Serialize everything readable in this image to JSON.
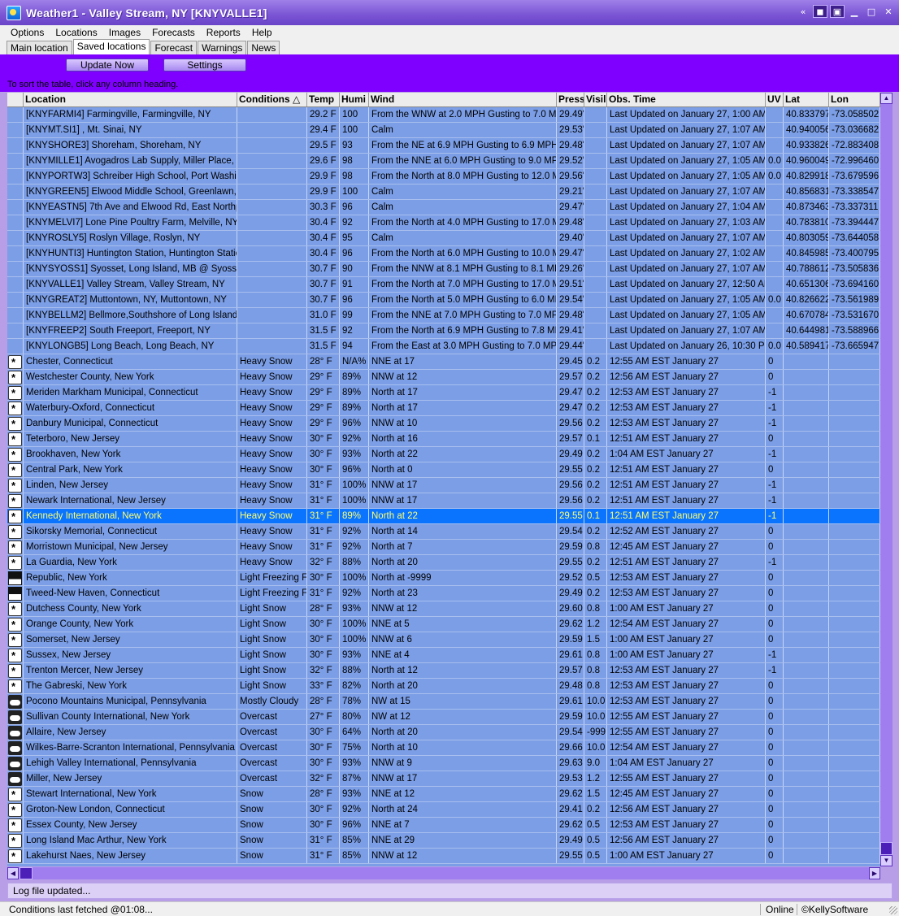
{
  "window": {
    "title": "Weather1 - Valley Stream, NY [KNYVALLE1]"
  },
  "menu": [
    "Options",
    "Locations",
    "Images",
    "Forecasts",
    "Reports",
    "Help"
  ],
  "tabs": [
    {
      "label": "Main location",
      "active": false
    },
    {
      "label": "Saved locations",
      "active": true
    },
    {
      "label": "Forecast",
      "active": false
    },
    {
      "label": "Warnings",
      "active": false
    },
    {
      "label": "News",
      "active": false
    }
  ],
  "toolbar": {
    "update_label": "Update Now",
    "settings_label": "Settings"
  },
  "hint": "To sort the table, click any column heading.",
  "columns": [
    "",
    "Location",
    "Conditions △",
    "Temp",
    "Humi",
    "Wind",
    "Press",
    "Visil",
    "Obs. Time",
    "UV",
    "Lat",
    "Lon"
  ],
  "rows": [
    {
      "icon": "",
      "location": "[KNYFARMI4] Farmingville, Farmingville, NY",
      "conditions": "",
      "temp": "29.2 F",
      "humidity": "100",
      "wind": "From the WNW at 2.0 MPH Gusting to 7.0 MPH",
      "press": "29.49\"",
      "vis": "",
      "obs": "Last Updated on January 27, 1:00 AM E",
      "uv": "",
      "lat": "40.833797",
      "lon": "-73.058502"
    },
    {
      "icon": "",
      "location": "[KNYMT.SI1] , Mt. Sinai, NY",
      "conditions": "",
      "temp": "29.4 F",
      "humidity": "100",
      "wind": "Calm",
      "press": "29.53\"",
      "vis": "",
      "obs": "Last Updated on January 27, 1:07 AM E",
      "uv": "",
      "lat": "40.940056",
      "lon": "-73.036682"
    },
    {
      "icon": "",
      "location": "[KNYSHORE3] Shoreham, Shoreham, NY",
      "conditions": "",
      "temp": "29.5 F",
      "humidity": "93",
      "wind": "From the NE at 6.9 MPH Gusting to 6.9 MPH",
      "press": "29.48\"",
      "vis": "",
      "obs": "Last Updated on January 27, 1:07 AM E",
      "uv": "",
      "lat": "40.933826",
      "lon": "-72.883408"
    },
    {
      "icon": "",
      "location": "[KNYMILLE1] Avogadros Lab Supply, Miller Place, NY",
      "conditions": "",
      "temp": "29.6 F",
      "humidity": "98",
      "wind": "From the NNE at 6.0 MPH Gusting to 9.0 MPH",
      "press": "29.52\"",
      "vis": "",
      "obs": "Last Updated on January 27, 1:05 AM E",
      "uv": "0.0",
      "lat": "40.960049",
      "lon": "-72.996460"
    },
    {
      "icon": "",
      "location": "[KNYPORTW3] Schreiber High School, Port Washington",
      "conditions": "",
      "temp": "29.9 F",
      "humidity": "98",
      "wind": "From the North at 8.0 MPH Gusting to 12.0 MPH",
      "press": "29.56\"",
      "vis": "",
      "obs": "Last Updated on January 27, 1:05 AM E",
      "uv": "0.0",
      "lat": "40.829918",
      "lon": "-73.679596"
    },
    {
      "icon": "",
      "location": "[KNYGREEN5] Elwood Middle School, Greenlawn, NY",
      "conditions": "",
      "temp": "29.9 F",
      "humidity": "100",
      "wind": "Calm",
      "press": "29.21\"",
      "vis": "",
      "obs": "Last Updated on January 27, 1:07 AM E",
      "uv": "",
      "lat": "40.856831",
      "lon": "-73.338547"
    },
    {
      "icon": "",
      "location": "[KNYEASTN5] 7th Ave and Elwood Rd, East Northport",
      "conditions": "",
      "temp": "30.3 F",
      "humidity": "96",
      "wind": "Calm",
      "press": "29.47\"",
      "vis": "",
      "obs": "Last Updated on January 27, 1:04 AM E",
      "uv": "",
      "lat": "40.873463",
      "lon": "-73.337311"
    },
    {
      "icon": "",
      "location": "[KNYMELVI7] Lone Pine Poultry Farm, Melville, NY",
      "conditions": "",
      "temp": "30.4 F",
      "humidity": "92",
      "wind": "From the North at 4.0 MPH Gusting to 17.0 MPH",
      "press": "29.48\"",
      "vis": "",
      "obs": "Last Updated on January 27, 1:03 AM E",
      "uv": "",
      "lat": "40.783810",
      "lon": "-73.394447"
    },
    {
      "icon": "",
      "location": "[KNYROSLY5] Roslyn Village, Roslyn, NY",
      "conditions": "",
      "temp": "30.4 F",
      "humidity": "95",
      "wind": "Calm",
      "press": "29.40\"",
      "vis": "",
      "obs": "Last Updated on January 27, 1:07 AM E",
      "uv": "",
      "lat": "40.803059",
      "lon": "-73.644058"
    },
    {
      "icon": "",
      "location": "[KNYHUNTI3] Huntington Station, Huntington Station,",
      "conditions": "",
      "temp": "30.4 F",
      "humidity": "96",
      "wind": "From the North at 6.0 MPH Gusting to 10.0 MPH",
      "press": "29.47\"",
      "vis": "",
      "obs": "Last Updated on January 27, 1:02 AM E",
      "uv": "",
      "lat": "40.845985",
      "lon": "-73.400795"
    },
    {
      "icon": "",
      "location": "[KNYSYOSS1] Syosset, Long Island, MB @ Syosset, N",
      "conditions": "",
      "temp": "30.7 F",
      "humidity": "90",
      "wind": "From the NNW at 8.1 MPH Gusting to 8.1 MPH",
      "press": "29.26\"",
      "vis": "",
      "obs": "Last Updated on January 27, 1:07 AM E",
      "uv": "",
      "lat": "40.788612",
      "lon": "-73.505836"
    },
    {
      "icon": "",
      "location": "[KNYVALLE1] Valley Stream, Valley Stream, NY",
      "conditions": "",
      "temp": "30.7 F",
      "humidity": "91",
      "wind": "From the North at 7.0 MPH Gusting to 17.0 MPH",
      "press": "29.51\"",
      "vis": "",
      "obs": "Last Updated on January 27, 12:50 AM",
      "uv": "",
      "lat": "40.651306",
      "lon": "-73.694160"
    },
    {
      "icon": "",
      "location": "[KNYGREAT2] Muttontown, NY, Muttontown, NY",
      "conditions": "",
      "temp": "30.7 F",
      "humidity": "96",
      "wind": "From the North at 5.0 MPH Gusting to 6.0 MPH",
      "press": "29.54\"",
      "vis": "",
      "obs": "Last Updated on January 27, 1:05 AM E",
      "uv": "0.0",
      "lat": "40.826622",
      "lon": "-73.561989"
    },
    {
      "icon": "",
      "location": "[KNYBELLM2] Bellmore,Southshore of Long Island, Bel",
      "conditions": "",
      "temp": "31.0 F",
      "humidity": "99",
      "wind": "From the NNE at 7.0 MPH Gusting to 7.0 MPH",
      "press": "29.48\"",
      "vis": "",
      "obs": "Last Updated on January 27, 1:05 AM E",
      "uv": "",
      "lat": "40.670784",
      "lon": "-73.531670"
    },
    {
      "icon": "",
      "location": "[KNYFREEP2] South Freeport, Freeport, NY",
      "conditions": "",
      "temp": "31.5 F",
      "humidity": "92",
      "wind": "From the North at 6.9 MPH Gusting to 7.8 MPH",
      "press": "29.41\"",
      "vis": "",
      "obs": "Last Updated on January 27, 1:07 AM E",
      "uv": "",
      "lat": "40.644981",
      "lon": "-73.588966"
    },
    {
      "icon": "",
      "location": "[KNYLONGB5] Long Beach, Long Beach, NY",
      "conditions": "",
      "temp": "31.5 F",
      "humidity": "94",
      "wind": "From the East at 3.0 MPH Gusting to 7.0 MPH",
      "press": "29.44\"",
      "vis": "",
      "obs": "Last Updated on January 26, 10:30 PM",
      "uv": "0.0",
      "lat": "40.589417",
      "lon": "-73.665947"
    },
    {
      "icon": "snow",
      "location": "Chester, Connecticut",
      "conditions": "Heavy Snow",
      "temp": "28° F",
      "humidity": "N/A%",
      "wind": "NNE at 17",
      "press": "29.45",
      "vis": "0.2",
      "obs": "12:55 AM EST January 27",
      "uv": "0",
      "lat": "",
      "lon": ""
    },
    {
      "icon": "snow",
      "location": "Westchester County, New York",
      "conditions": "Heavy Snow",
      "temp": "29° F",
      "humidity": "89%",
      "wind": "NNW at 12",
      "press": "29.57",
      "vis": "0.2",
      "obs": "12:56 AM EST January 27",
      "uv": "0",
      "lat": "",
      "lon": ""
    },
    {
      "icon": "snow",
      "location": "Meriden Markham Municipal, Connecticut",
      "conditions": "Heavy Snow",
      "temp": "29° F",
      "humidity": "89%",
      "wind": "North at 17",
      "press": "29.47",
      "vis": "0.2",
      "obs": "12:53 AM EST January 27",
      "uv": "-1",
      "lat": "",
      "lon": ""
    },
    {
      "icon": "snow",
      "location": "Waterbury-Oxford, Connecticut",
      "conditions": "Heavy Snow",
      "temp": "29° F",
      "humidity": "89%",
      "wind": "North at 17",
      "press": "29.47",
      "vis": "0.2",
      "obs": "12:53 AM EST January 27",
      "uv": "-1",
      "lat": "",
      "lon": ""
    },
    {
      "icon": "snow",
      "location": "Danbury Municipal, Connecticut",
      "conditions": "Heavy Snow",
      "temp": "29° F",
      "humidity": "96%",
      "wind": "NNW at 10",
      "press": "29.56",
      "vis": "0.2",
      "obs": "12:53 AM EST January 27",
      "uv": "-1",
      "lat": "",
      "lon": ""
    },
    {
      "icon": "snow",
      "location": "Teterboro, New Jersey",
      "conditions": "Heavy Snow",
      "temp": "30° F",
      "humidity": "92%",
      "wind": "North at 16",
      "press": "29.57",
      "vis": "0.1",
      "obs": "12:51 AM EST January 27",
      "uv": "0",
      "lat": "",
      "lon": ""
    },
    {
      "icon": "snow",
      "location": "Brookhaven, New York",
      "conditions": "Heavy Snow",
      "temp": "30° F",
      "humidity": "93%",
      "wind": "North at 22",
      "press": "29.49",
      "vis": "0.2",
      "obs": "1:04 AM EST January 27",
      "uv": "-1",
      "lat": "",
      "lon": ""
    },
    {
      "icon": "snow",
      "location": "Central Park, New York",
      "conditions": "Heavy Snow",
      "temp": "30° F",
      "humidity": "96%",
      "wind": "North at 0",
      "press": "29.55",
      "vis": "0.2",
      "obs": "12:51 AM EST January 27",
      "uv": "0",
      "lat": "",
      "lon": ""
    },
    {
      "icon": "snow",
      "location": "Linden, New Jersey",
      "conditions": "Heavy Snow",
      "temp": "31° F",
      "humidity": "100%",
      "wind": "NNW at 17",
      "press": "29.56",
      "vis": "0.2",
      "obs": "12:51 AM EST January 27",
      "uv": "-1",
      "lat": "",
      "lon": ""
    },
    {
      "icon": "snow",
      "location": "Newark International, New Jersey",
      "conditions": "Heavy Snow",
      "temp": "31° F",
      "humidity": "100%",
      "wind": "NNW at 17",
      "press": "29.56",
      "vis": "0.2",
      "obs": "12:51 AM EST January 27",
      "uv": "-1",
      "lat": "",
      "lon": ""
    },
    {
      "icon": "snow",
      "location": "Kennedy International, New York",
      "conditions": "Heavy Snow",
      "temp": "31° F",
      "humidity": "89%",
      "wind": "North at 22",
      "press": "29.55",
      "vis": "0.1",
      "obs": "12:51 AM EST January 27",
      "uv": "-1",
      "lat": "",
      "lon": "",
      "selected": true
    },
    {
      "icon": "snow",
      "location": "Sikorsky Memorial, Connecticut",
      "conditions": "Heavy Snow",
      "temp": "31° F",
      "humidity": "92%",
      "wind": "North at 14",
      "press": "29.54",
      "vis": "0.2",
      "obs": "12:52 AM EST January 27",
      "uv": "0",
      "lat": "",
      "lon": ""
    },
    {
      "icon": "snow",
      "location": "Morristown Municipal, New Jersey",
      "conditions": "Heavy Snow",
      "temp": "31° F",
      "humidity": "92%",
      "wind": "North at 7",
      "press": "29.59",
      "vis": "0.8",
      "obs": "12:45 AM EST January 27",
      "uv": "0",
      "lat": "",
      "lon": ""
    },
    {
      "icon": "snow",
      "location": "La Guardia, New York",
      "conditions": "Heavy Snow",
      "temp": "32° F",
      "humidity": "88%",
      "wind": "North at 20",
      "press": "29.55",
      "vis": "0.2",
      "obs": "12:51 AM EST January 27",
      "uv": "-1",
      "lat": "",
      "lon": ""
    },
    {
      "icon": "fog",
      "location": "Republic, New York",
      "conditions": "Light Freezing Fo",
      "temp": "30° F",
      "humidity": "100%",
      "wind": "North at -9999",
      "press": "29.52",
      "vis": "0.5",
      "obs": "12:53 AM EST January 27",
      "uv": "0",
      "lat": "",
      "lon": ""
    },
    {
      "icon": "fog",
      "location": "Tweed-New Haven, Connecticut",
      "conditions": "Light Freezing Fo",
      "temp": "31° F",
      "humidity": "92%",
      "wind": "North at 23",
      "press": "29.49",
      "vis": "0.2",
      "obs": "12:53 AM EST January 27",
      "uv": "0",
      "lat": "",
      "lon": ""
    },
    {
      "icon": "snow",
      "location": "Dutchess County, New York",
      "conditions": "Light Snow",
      "temp": "28° F",
      "humidity": "93%",
      "wind": "NNW at 12",
      "press": "29.60",
      "vis": "0.8",
      "obs": "1:00 AM EST January 27",
      "uv": "0",
      "lat": "",
      "lon": ""
    },
    {
      "icon": "snow",
      "location": "Orange County, New York",
      "conditions": "Light Snow",
      "temp": "30° F",
      "humidity": "100%",
      "wind": "NNE at 5",
      "press": "29.62",
      "vis": "1.2",
      "obs": "12:54 AM EST January 27",
      "uv": "0",
      "lat": "",
      "lon": ""
    },
    {
      "icon": "snow",
      "location": "Somerset, New Jersey",
      "conditions": "Light Snow",
      "temp": "30° F",
      "humidity": "100%",
      "wind": "NNW at 6",
      "press": "29.59",
      "vis": "1.5",
      "obs": "1:00 AM EST January 27",
      "uv": "0",
      "lat": "",
      "lon": ""
    },
    {
      "icon": "snow",
      "location": "Sussex, New Jersey",
      "conditions": "Light Snow",
      "temp": "30° F",
      "humidity": "93%",
      "wind": "NNE at 4",
      "press": "29.61",
      "vis": "0.8",
      "obs": "1:00 AM EST January 27",
      "uv": "-1",
      "lat": "",
      "lon": ""
    },
    {
      "icon": "snow",
      "location": "Trenton Mercer, New Jersey",
      "conditions": "Light Snow",
      "temp": "32° F",
      "humidity": "88%",
      "wind": "North at 12",
      "press": "29.57",
      "vis": "0.8",
      "obs": "12:53 AM EST January 27",
      "uv": "-1",
      "lat": "",
      "lon": ""
    },
    {
      "icon": "snow",
      "location": "The Gabreski, New York",
      "conditions": "Light Snow",
      "temp": "33° F",
      "humidity": "82%",
      "wind": "North at 20",
      "press": "29.48",
      "vis": "0.8",
      "obs": "12:53 AM EST January 27",
      "uv": "0",
      "lat": "",
      "lon": ""
    },
    {
      "icon": "cloud",
      "location": "Pocono Mountains Municipal, Pennsylvania",
      "conditions": "Mostly Cloudy",
      "temp": "28° F",
      "humidity": "78%",
      "wind": "NW at 15",
      "press": "29.61",
      "vis": "10.0",
      "obs": "12:53 AM EST January 27",
      "uv": "0",
      "lat": "",
      "lon": ""
    },
    {
      "icon": "cloud",
      "location": "Sullivan County International, New York",
      "conditions": "Overcast",
      "temp": "27° F",
      "humidity": "80%",
      "wind": "NW at 12",
      "press": "29.59",
      "vis": "10.0",
      "obs": "12:55 AM EST January 27",
      "uv": "0",
      "lat": "",
      "lon": ""
    },
    {
      "icon": "cloud",
      "location": "Allaire, New Jersey",
      "conditions": "Overcast",
      "temp": "30° F",
      "humidity": "64%",
      "wind": "North at 20",
      "press": "29.54",
      "vis": "-999",
      "obs": "12:55 AM EST January 27",
      "uv": "0",
      "lat": "",
      "lon": ""
    },
    {
      "icon": "cloud",
      "location": "Wilkes-Barre-Scranton International, Pennsylvania",
      "conditions": "Overcast",
      "temp": "30° F",
      "humidity": "75%",
      "wind": "North at 10",
      "press": "29.66",
      "vis": "10.0",
      "obs": "12:54 AM EST January 27",
      "uv": "0",
      "lat": "",
      "lon": ""
    },
    {
      "icon": "cloud",
      "location": "Lehigh Valley International, Pennsylvania",
      "conditions": "Overcast",
      "temp": "30° F",
      "humidity": "93%",
      "wind": "NNW at 9",
      "press": "29.63",
      "vis": "9.0",
      "obs": "1:04 AM EST January 27",
      "uv": "0",
      "lat": "",
      "lon": ""
    },
    {
      "icon": "cloud",
      "location": "Miller, New Jersey",
      "conditions": "Overcast",
      "temp": "32° F",
      "humidity": "87%",
      "wind": "NNW at 17",
      "press": "29.53",
      "vis": "1.2",
      "obs": "12:55 AM EST January 27",
      "uv": "0",
      "lat": "",
      "lon": ""
    },
    {
      "icon": "snow",
      "location": "Stewart International, New York",
      "conditions": "Snow",
      "temp": "28° F",
      "humidity": "93%",
      "wind": "NNE at 12",
      "press": "29.62",
      "vis": "1.5",
      "obs": "12:45 AM EST January 27",
      "uv": "0",
      "lat": "",
      "lon": ""
    },
    {
      "icon": "snow",
      "location": "Groton-New London, Connecticut",
      "conditions": "Snow",
      "temp": "30° F",
      "humidity": "92%",
      "wind": "North at 24",
      "press": "29.41",
      "vis": "0.2",
      "obs": "12:56 AM EST January 27",
      "uv": "0",
      "lat": "",
      "lon": ""
    },
    {
      "icon": "snow",
      "location": "Essex County, New Jersey",
      "conditions": "Snow",
      "temp": "30° F",
      "humidity": "96%",
      "wind": "NNE at 7",
      "press": "29.62",
      "vis": "0.5",
      "obs": "12:53 AM EST January 27",
      "uv": "0",
      "lat": "",
      "lon": ""
    },
    {
      "icon": "snow",
      "location": "Long Island Mac Arthur, New York",
      "conditions": "Snow",
      "temp": "31° F",
      "humidity": "85%",
      "wind": "NNE at 29",
      "press": "29.49",
      "vis": "0.5",
      "obs": "12:56 AM EST January 27",
      "uv": "0",
      "lat": "",
      "lon": ""
    },
    {
      "icon": "snow",
      "location": "Lakehurst Naes, New Jersey",
      "conditions": "Snow",
      "temp": "31° F",
      "humidity": "85%",
      "wind": "NNW at 12",
      "press": "29.55",
      "vis": "0.5",
      "obs": "1:00 AM EST January 27",
      "uv": "0",
      "lat": "",
      "lon": ""
    }
  ],
  "log": {
    "text": "Log file updated..."
  },
  "status": {
    "left": "Conditions last fetched @01:08...",
    "online": "Online",
    "copyright": "©KellySoftware"
  }
}
